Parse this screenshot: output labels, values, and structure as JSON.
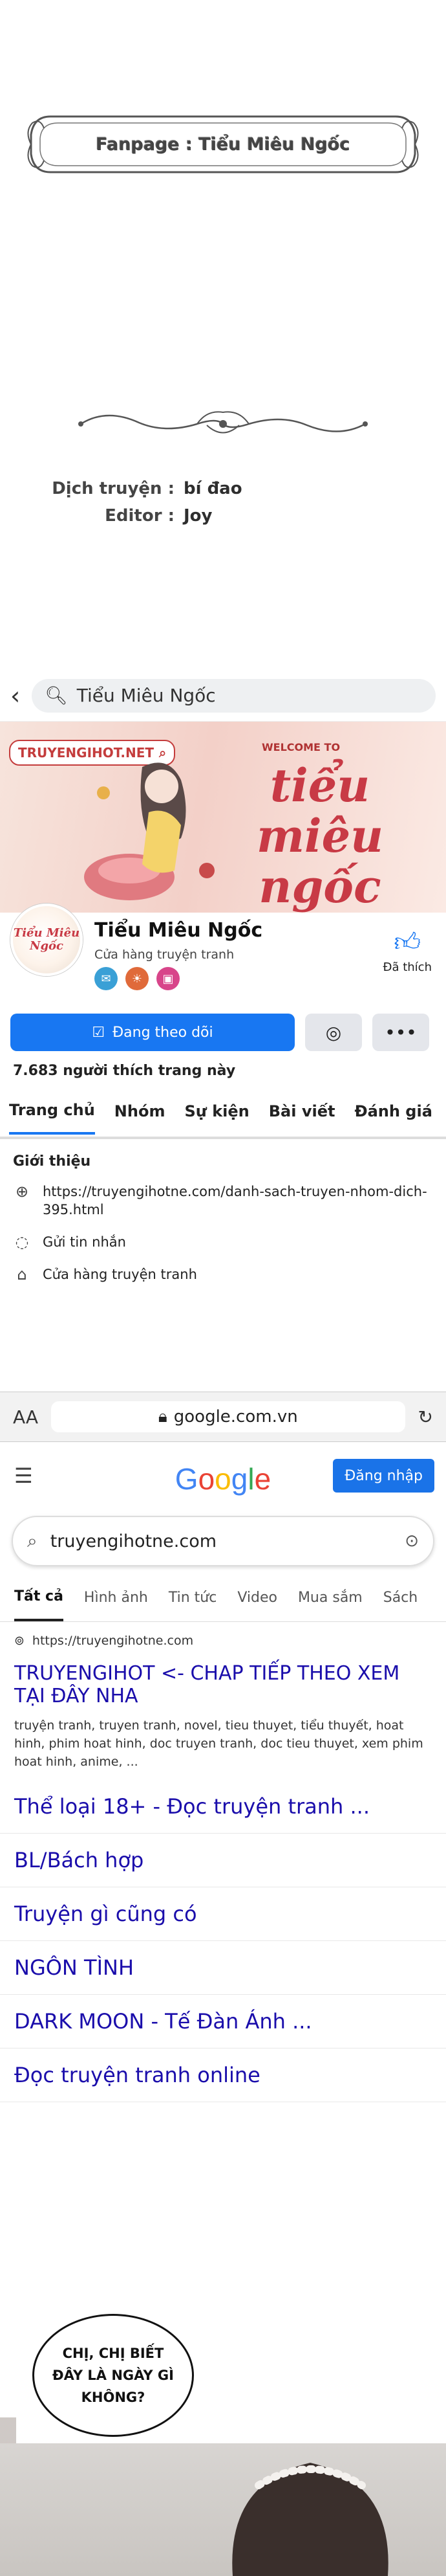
{
  "credits": {
    "fanpage_label": "Fanpage : Tiểu Miêu Ngốc",
    "translator_key": "Dịch truyện :",
    "translator_value": "bí đao",
    "editor_key": "Editor :",
    "editor_value": "Joy"
  },
  "facebook": {
    "search_text": "Tiểu Miêu Ngốc",
    "cover": {
      "brand": "TRUYENGIHOT.NET",
      "welcome": "WELCOME TO",
      "title_line1": "tiểu",
      "title_line2": "miêu",
      "title_line3": "ngốc"
    },
    "avatar_text": "Tiểu Miêu Ngốc",
    "page_name": "Tiểu Miêu Ngốc",
    "category": "Cửa hàng truyện tranh",
    "like_label": "Đã thích",
    "follow_label": "Đang theo dõi",
    "follower_count": "7.683 người thích trang này",
    "tabs": [
      "Trang chủ",
      "Nhóm",
      "Sự kiện",
      "Bài viết",
      "Đánh giá"
    ],
    "intro": {
      "heading": "Giới thiệu",
      "link": "https://truyengihotne.com/danh-sach-truyen-nhom-dich-395.html",
      "message": "Gửi tin nhắn",
      "shop": "Cửa hàng truyện tranh"
    }
  },
  "browser": {
    "text_size": "AA",
    "url": "google.com.vn"
  },
  "google": {
    "logo": "Google",
    "signin": "Đăng nhập",
    "query": "truyengihotne.com",
    "tabs": [
      "Tất cả",
      "Hình ảnh",
      "Tin tức",
      "Video",
      "Mua sắm",
      "Sách"
    ],
    "result_site": "https://truyengihotne.com",
    "result_title": "TRUYENGIHOT <- CHAP TIẾP THEO XEM TẠI ĐÂY NHA",
    "result_desc": "truyện tranh, truyen tranh, novel, tieu thuyet, tiểu thuyết, hoat hinh, phim hoat hinh, doc truyen tranh, doc tieu thuyet, xem phim hoat hinh, anime, ...",
    "links": [
      "Thể loại 18+ - Đọc truyện tranh ...",
      "BL/Bách hợp",
      "Truyện gì cũng có",
      "NGÔN TÌNH",
      "DARK MOON - Tế Đàn Ánh ...",
      "Đọc truyện tranh online"
    ]
  },
  "panel": {
    "bubble_line1": "CHỊ, CHỊ BIẾT",
    "bubble_line2": "ĐÂY LÀ NGÀY GÌ",
    "bubble_line3": "KHÔNG?"
  },
  "colors": {
    "facebook_blue": "#1877f2",
    "google_blue": "#1a73e8",
    "cover_red": "#c83a45"
  }
}
